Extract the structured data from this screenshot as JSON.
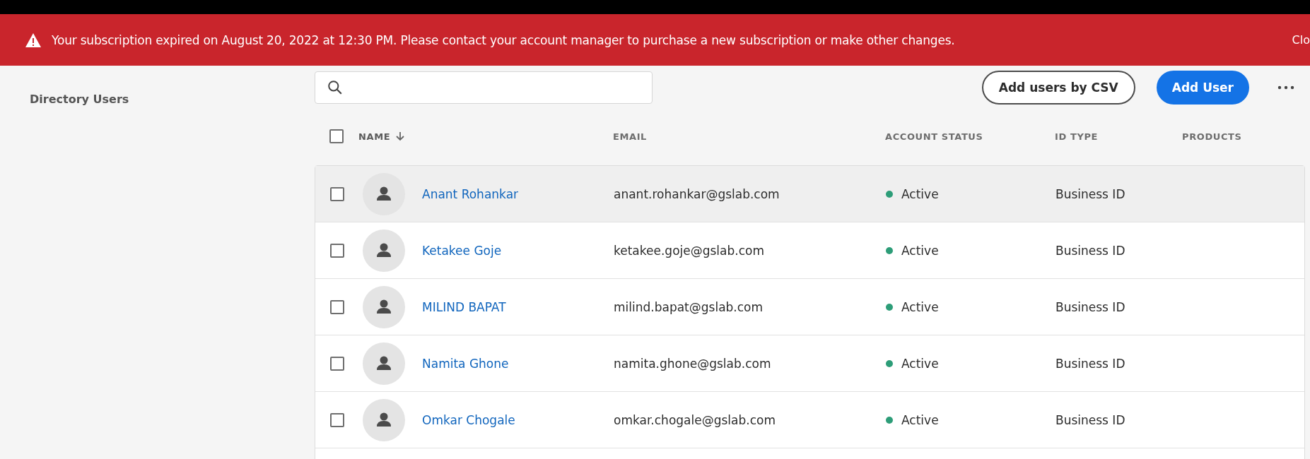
{
  "banner": {
    "message": "Your subscription expired on August 20, 2022 at 12:30 PM. Please contact your account manager to purchase a new subscription or make other changes.",
    "close_label": "Clo"
  },
  "sidebar": {
    "items": [
      {
        "label": "Directory Users"
      }
    ]
  },
  "buttons": {
    "csv": "Add users by CSV",
    "add": "Add User"
  },
  "table": {
    "select_all_checked": false,
    "columns": [
      {
        "label": "NAME",
        "sorted": true
      },
      {
        "label": "EMAIL",
        "sorted": false
      },
      {
        "label": "ACCOUNT STATUS",
        "sorted": false
      },
      {
        "label": "ID TYPE",
        "sorted": false
      },
      {
        "label": "PRODUCTS",
        "sorted": false
      }
    ],
    "rows": [
      {
        "name": "Anant Rohankar",
        "email": "anant.rohankar@gslab.com",
        "status": "Active",
        "color": "#2d9d78",
        "id_type": "Business ID",
        "checked": false,
        "highlighted": true
      },
      {
        "name": "Ketakee Goje",
        "email": "ketakee.goje@gslab.com",
        "status": "Active",
        "color": "#2d9d78",
        "id_type": "Business ID",
        "checked": false,
        "highlighted": false
      },
      {
        "name": "MILIND BAPAT",
        "email": "milind.bapat@gslab.com",
        "status": "Active",
        "color": "#2d9d78",
        "id_type": "Business ID",
        "checked": false,
        "highlighted": false
      },
      {
        "name": "Namita Ghone",
        "email": "namita.ghone@gslab.com",
        "status": "Active",
        "color": "#2d9d78",
        "id_type": "Business ID",
        "checked": false,
        "highlighted": false
      },
      {
        "name": "Omkar Chogale",
        "email": "omkar.chogale@gslab.com",
        "status": "Active",
        "color": "#2d9d78",
        "id_type": "Business ID",
        "checked": false,
        "highlighted": false
      }
    ]
  }
}
